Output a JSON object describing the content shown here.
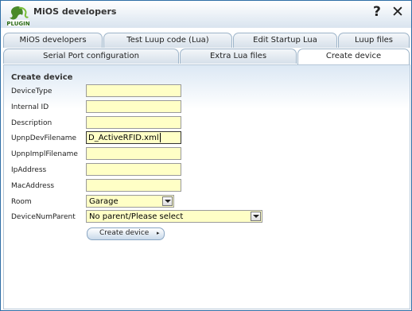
{
  "window": {
    "title": "MiOS developers",
    "help_label": "?",
    "close_label": "✕",
    "logo_text": "PLUGIN"
  },
  "tabs_top": [
    {
      "label": "MiOS developers"
    },
    {
      "label": "Test Luup code (Lua)"
    },
    {
      "label": "Edit Startup Lua"
    },
    {
      "label": "Luup files"
    }
  ],
  "tabs_second": [
    {
      "label": "Serial Port configuration"
    },
    {
      "label": "Extra Lua files"
    },
    {
      "label": "Create device",
      "active": true
    }
  ],
  "form": {
    "heading": "Create device",
    "fields": [
      {
        "label": "DeviceType",
        "value": ""
      },
      {
        "label": "Internal ID",
        "value": ""
      },
      {
        "label": "Description",
        "value": ""
      },
      {
        "label": "UpnpDevFilename",
        "value": "D_ActiveRFID.xml"
      },
      {
        "label": "UpnpImplFilename",
        "value": ""
      },
      {
        "label": "IpAddress",
        "value": ""
      },
      {
        "label": "MacAddress",
        "value": ""
      }
    ],
    "room": {
      "label": "Room",
      "value": "Garage"
    },
    "parent": {
      "label": "DeviceNumParent",
      "value": "No parent/Please select"
    },
    "submit_label": "Create device",
    "submit_arrow": "▸"
  }
}
